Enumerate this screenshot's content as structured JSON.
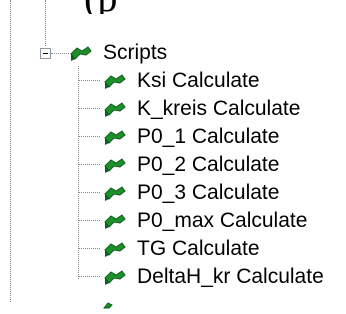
{
  "top_text": "(p",
  "tree": {
    "root": {
      "label": "Scripts",
      "icon": "script-icon",
      "expanded": true
    },
    "children": [
      {
        "label": "Ksi Calculate",
        "icon": "script-icon"
      },
      {
        "label": "K_kreis Calculate",
        "icon": "script-icon"
      },
      {
        "label": "P0_1 Calculate",
        "icon": "script-icon"
      },
      {
        "label": "P0_2 Calculate",
        "icon": "script-icon"
      },
      {
        "label": "P0_3 Calculate",
        "icon": "script-icon"
      },
      {
        "label": "P0_max Calculate",
        "icon": "script-icon"
      },
      {
        "label": "TG Calculate",
        "icon": "script-icon"
      },
      {
        "label": "DeltaH_kr Calculate",
        "icon": "script-icon"
      }
    ]
  },
  "colors": {
    "icon_green": "#1f8f2a",
    "icon_dark": "#0b5f1a",
    "tree_line": "#8a8a8a"
  }
}
